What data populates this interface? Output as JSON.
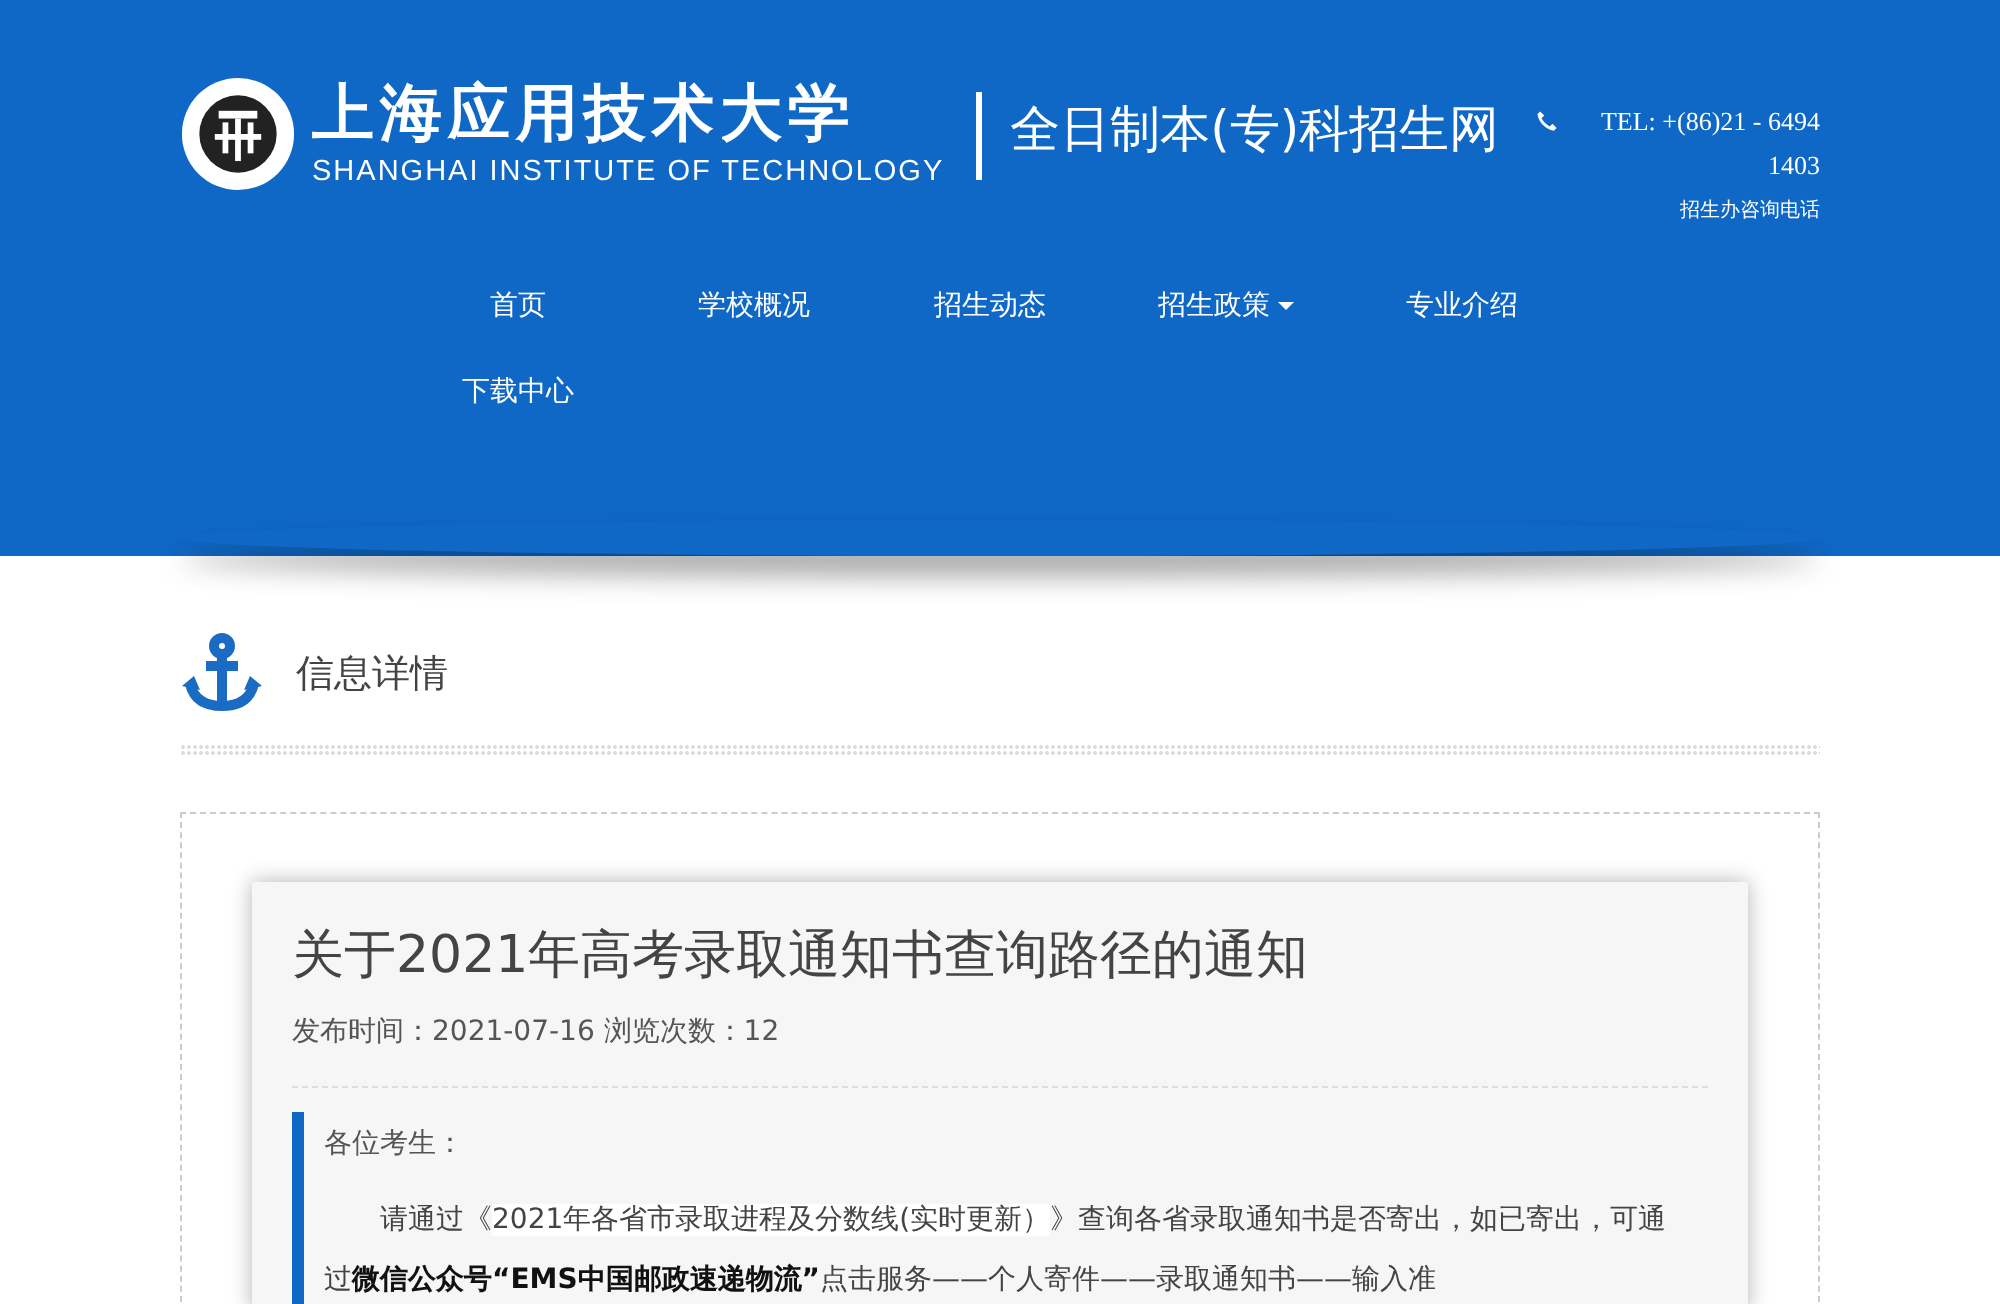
{
  "header": {
    "school_name_cn": "上海应用技术大学",
    "school_name_en": "SHANGHAI INSTITUTE OF TECHNOLOGY",
    "site_title": "全日制本(专)科招生网",
    "phone": "TEL: +(86)21 - 6494 1403",
    "phone_label": "招生办咨询电话"
  },
  "nav": [
    {
      "label": "首页",
      "dropdown": false
    },
    {
      "label": "学校概况",
      "dropdown": false
    },
    {
      "label": "招生动态",
      "dropdown": false
    },
    {
      "label": "招生政策",
      "dropdown": true
    },
    {
      "label": "专业介绍",
      "dropdown": false
    },
    {
      "label": "下载中心",
      "dropdown": false
    }
  ],
  "section_title": "信息详情",
  "article": {
    "title": "关于2021年高考录取通知书查询路径的通知",
    "meta": "发布时间：2021-07-16 浏览次数：12",
    "greeting": "各位考生：",
    "paragraph": [
      {
        "kind": "text",
        "text": "请通过《"
      },
      {
        "kind": "link",
        "text": "2021年各省市录取进程及分数线(实时更新）"
      },
      {
        "kind": "text",
        "text": "》查询各省录取通知书是否寄出，如已寄出，可通过"
      },
      {
        "kind": "bold",
        "text": "微信公众号“EMS中国邮政速递物流”"
      },
      {
        "kind": "text",
        "text": "点击服务——个人寄件——录取通知书——输入准"
      }
    ]
  }
}
